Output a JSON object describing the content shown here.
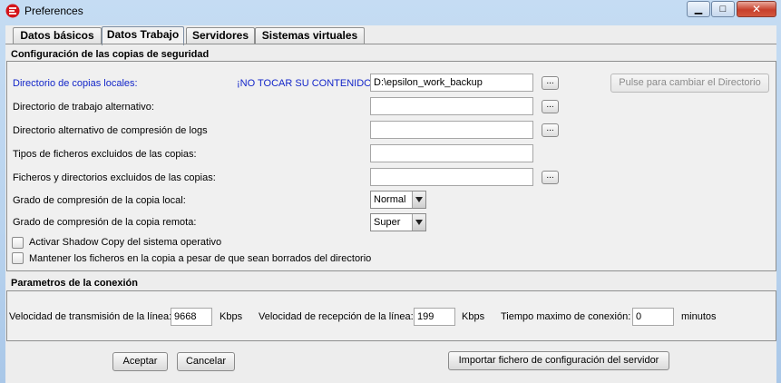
{
  "window": {
    "title": "Preferences",
    "icon": "app-logo-icon"
  },
  "tabs": [
    {
      "label": "Datos básicos",
      "active": false
    },
    {
      "label": "Datos Trabajo",
      "active": true
    },
    {
      "label": "Servidores",
      "active": false
    },
    {
      "label": "Sistemas virtuales",
      "active": false
    }
  ],
  "backup": {
    "section_title": "Configuración de las copias de seguridad",
    "local_dir_label": "Directorio de copias locales:",
    "warning": "¡NO TOCAR SU CONTENIDO!",
    "local_dir_value": "D:\\epsilon_work_backup",
    "change_dir_button": "Pulse para cambiar el Directorio",
    "alt_work_dir_label": "Directorio de trabajo alternativo:",
    "alt_work_dir_value": "",
    "alt_log_dir_label": "Directorio alternativo de compresión de logs",
    "alt_log_dir_value": "",
    "excluded_types_label": "Tipos de ficheros excluidos de las copias:",
    "excluded_types_value": "",
    "excluded_paths_label": "Ficheros y directorios excluidos de las copias:",
    "excluded_paths_value": "",
    "local_compression_label": "Grado de compresión de la copia local:",
    "local_compression_value": "Normal",
    "remote_compression_label": "Grado de compresión de la copia remota:",
    "remote_compression_value": "Super",
    "shadow_copy_label": "Activar Shadow Copy del sistema operativo",
    "shadow_copy_checked": false,
    "keep_files_label": "Mantener los ficheros en la copia a pesar de que sean borrados del directorio",
    "keep_files_checked": false,
    "browse_label": "..."
  },
  "connection": {
    "section_title": "Parametros de la conexión",
    "tx_label": "Velocidad de transmisión de la línea:",
    "tx_value": "9668",
    "tx_unit": "Kbps",
    "rx_label": "Velocidad de recepción de la línea:",
    "rx_value": "199",
    "rx_unit": "Kbps",
    "timeout_label": "Tiempo maximo de conexión:",
    "timeout_value": "0",
    "timeout_unit": "minutos"
  },
  "footer": {
    "accept": "Aceptar",
    "cancel": "Cancelar",
    "import": "Importar fichero de configuración del servidor"
  }
}
